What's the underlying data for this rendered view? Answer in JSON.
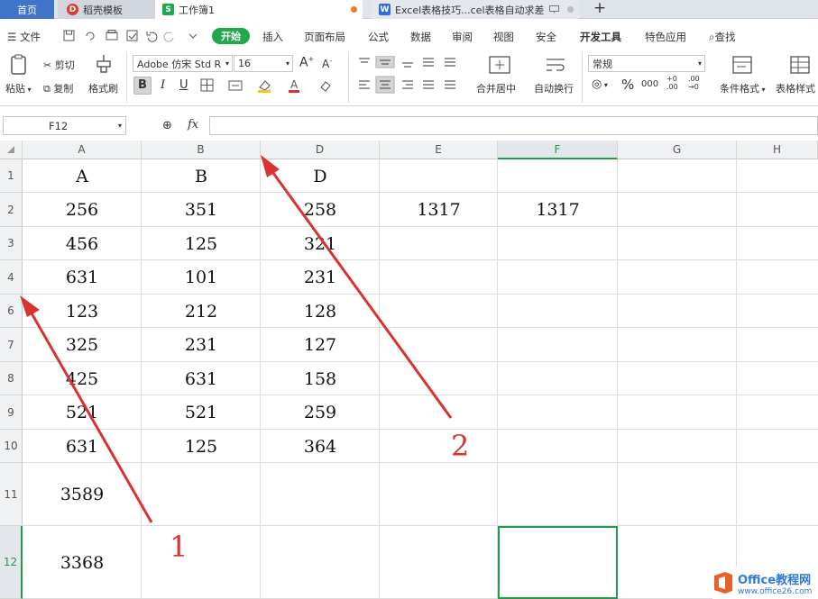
{
  "tabs": {
    "home": "首页",
    "daoke": "稻壳模板",
    "work": "工作簿1",
    "excel": "Excel表格技巧...cel表格自动求差",
    "new": "+"
  },
  "menu": {
    "file": "文件",
    "start": "开始",
    "items": [
      "插入",
      "页面布局",
      "公式",
      "数据",
      "审阅",
      "视图",
      "安全",
      "开发工具",
      "特色应用"
    ],
    "search": "查找"
  },
  "ribbon": {
    "paste": "粘贴",
    "cut": "剪切",
    "copy": "复制",
    "format_painter": "格式刷",
    "font_name": "Adobe 仿宋 Std R",
    "font_size": "16",
    "merge": "合并居中",
    "wrap": "自动换行",
    "number_format": "常规",
    "percent": "%",
    "thousands": "000",
    "cond_format": "条件格式",
    "table_style": "表格样式"
  },
  "formula_bar": {
    "name_box": "F12",
    "fx": "fx",
    "content": ""
  },
  "columns": [
    "A",
    "B",
    "D",
    "E",
    "F",
    "G",
    "H"
  ],
  "rows": [
    {
      "num": "1",
      "cells": [
        "A",
        "B",
        "D",
        "",
        "",
        "",
        ""
      ]
    },
    {
      "num": "2",
      "cells": [
        "256",
        "351",
        "258",
        "1317",
        "1317",
        "",
        ""
      ]
    },
    {
      "num": "3",
      "cells": [
        "456",
        "125",
        "321",
        "",
        "",
        "",
        ""
      ]
    },
    {
      "num": "4",
      "cells": [
        "631",
        "101",
        "231",
        "",
        "",
        "",
        ""
      ]
    },
    {
      "num": "6",
      "cells": [
        "123",
        "212",
        "128",
        "",
        "",
        "",
        ""
      ]
    },
    {
      "num": "7",
      "cells": [
        "325",
        "231",
        "127",
        "",
        "",
        "",
        ""
      ]
    },
    {
      "num": "8",
      "cells": [
        "425",
        "631",
        "158",
        "",
        "",
        "",
        ""
      ]
    },
    {
      "num": "9",
      "cells": [
        "521",
        "521",
        "259",
        "",
        "",
        "",
        ""
      ]
    },
    {
      "num": "10",
      "cells": [
        "631",
        "125",
        "364",
        "",
        "",
        "",
        ""
      ]
    },
    {
      "num": "11",
      "cells": [
        "3589",
        "",
        "",
        "",
        "",
        "",
        ""
      ]
    },
    {
      "num": "12",
      "cells": [
        "3368",
        "",
        "",
        "",
        "",
        "",
        ""
      ]
    }
  ],
  "selected": {
    "column": "F",
    "row": "12"
  },
  "annotations": [
    "1",
    "2"
  ],
  "watermark": {
    "title": "Office教程网",
    "url": "www.office26.com"
  },
  "colors": {
    "accent": "#219a4a",
    "arrow": "#d8332f",
    "tab_home": "#3f74c9"
  }
}
